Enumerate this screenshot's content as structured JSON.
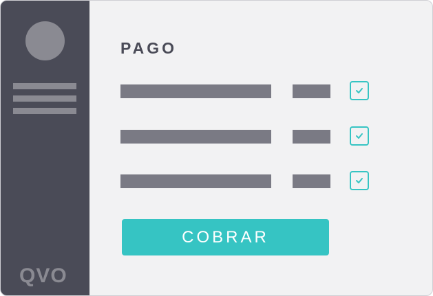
{
  "sidebar": {
    "logo_text": "QVO",
    "menu_items": 3
  },
  "main": {
    "title": "PAGO",
    "rows": [
      {
        "checked": true
      },
      {
        "checked": true
      },
      {
        "checked": true
      }
    ],
    "cta_label": "COBRAR"
  },
  "colors": {
    "sidebar_bg": "#4a4b57",
    "content_bg": "#f2f2f3",
    "placeholder": "#7a7a84",
    "accent": "#36c4c3"
  },
  "icons": [
    "avatar",
    "menu-icon",
    "check-icon"
  ]
}
